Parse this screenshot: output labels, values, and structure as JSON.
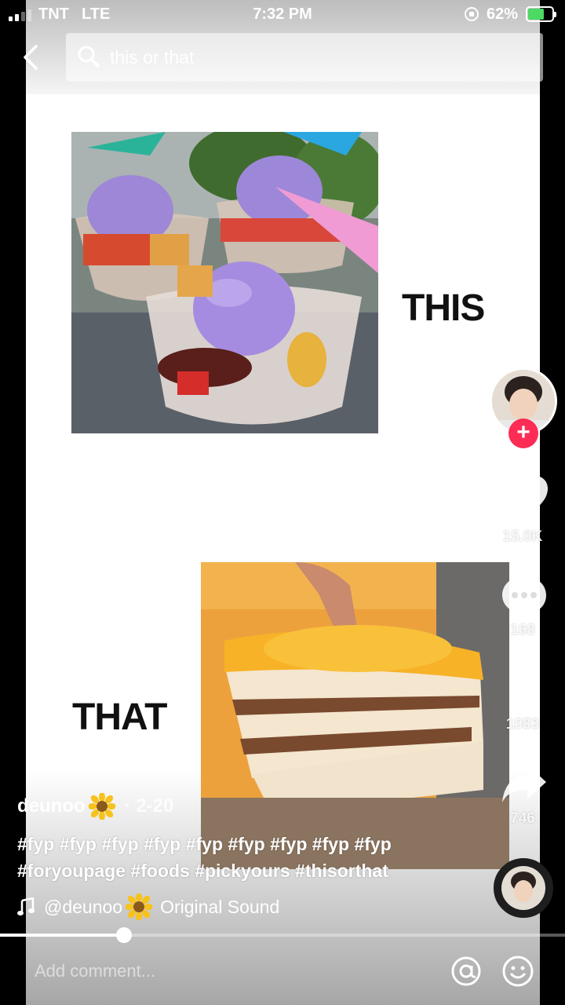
{
  "status_bar": {
    "carrier": "TNT",
    "network": "LTE",
    "time": "7:32 PM",
    "battery_percent": "62%"
  },
  "search": {
    "query": "this or that"
  },
  "video": {
    "label_top": "THIS",
    "label_bottom": "THAT"
  },
  "rail": {
    "likes": "15.0K",
    "comments": "168",
    "saves": "1083",
    "shares": "746"
  },
  "caption": {
    "username": "deunoo",
    "date": "· 2-20",
    "hashtags_line1": "#fyp #fyp #fyp #fyp #fyp #fyp #fyp #fyp #fyp",
    "hashtags_line2": "#foryoupage #foods #pickyours #thisorthat"
  },
  "sound": {
    "user": "@deunoo",
    "title": "Original Sound"
  },
  "progress": {
    "played_fraction": 0.22
  },
  "comment": {
    "placeholder": "Add comment..."
  },
  "colors": {
    "follow_button": "#fe2c55",
    "battery_fill": "#4cd964"
  }
}
